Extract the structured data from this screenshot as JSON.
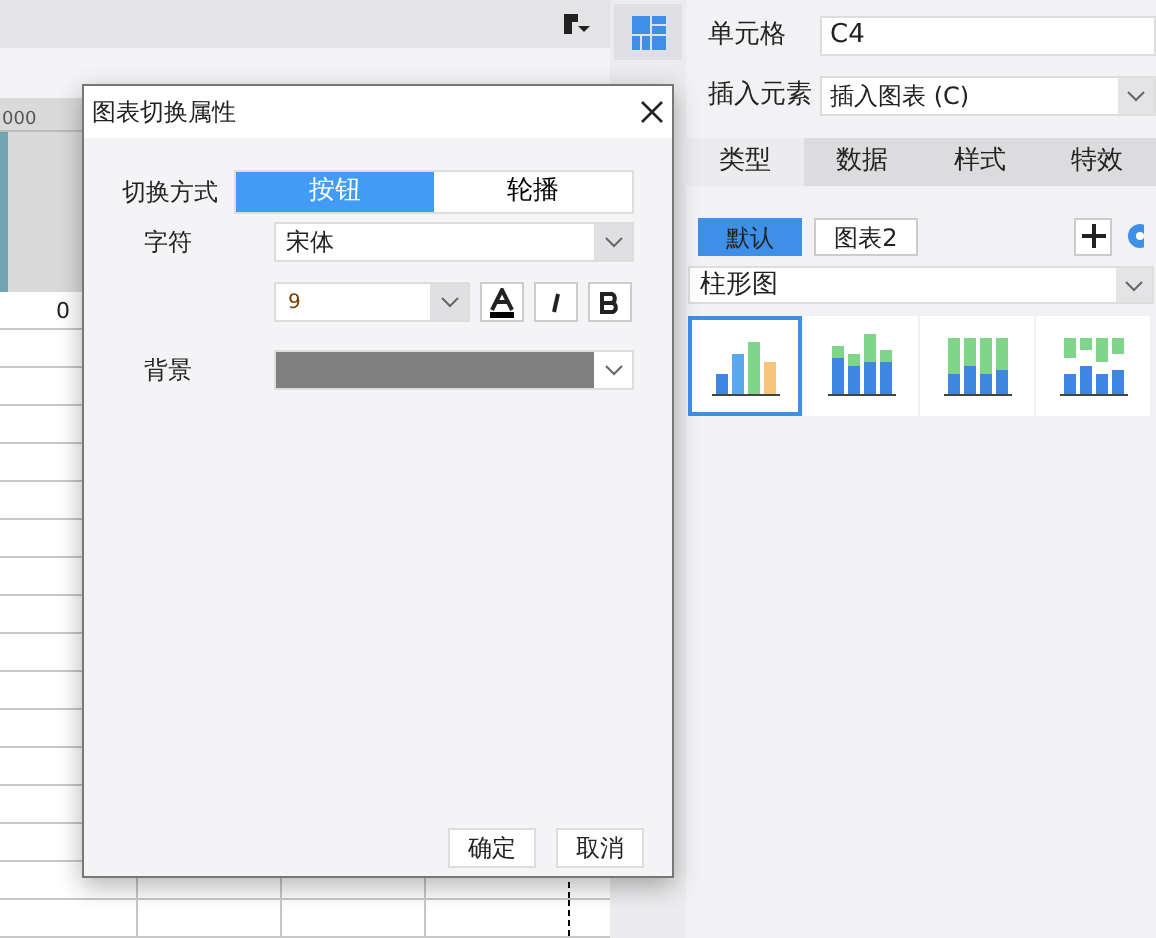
{
  "sheet": {
    "ruler_text": "000",
    "cell_value": "0"
  },
  "right_panel": {
    "cell_label": "单元格",
    "cell_value": "C4",
    "insert_label": "插入元素",
    "insert_value": "插入图表 (C)",
    "tabs": [
      {
        "label": "类型",
        "selected": true
      },
      {
        "label": "数据",
        "selected": false
      },
      {
        "label": "样式",
        "selected": false
      },
      {
        "label": "特效",
        "selected": false
      }
    ],
    "chart_tabs": [
      {
        "label": "默认",
        "selected": true
      },
      {
        "label": "图表2",
        "selected": false
      }
    ],
    "chart_type": "柱形图",
    "thumbnails": [
      {
        "kind": "clustered",
        "selected": true
      },
      {
        "kind": "stacked",
        "selected": false
      },
      {
        "kind": "percent",
        "selected": false
      },
      {
        "kind": "floating",
        "selected": false
      }
    ]
  },
  "dialog": {
    "title": "图表切换属性",
    "switch_label": "切换方式",
    "switch_options": [
      {
        "label": "按钮",
        "selected": true
      },
      {
        "label": "轮播",
        "selected": false
      }
    ],
    "font_label": "字符",
    "font_value": "宋体",
    "size_value": "9",
    "background_label": "背景",
    "buttons": [
      "确定",
      "取消"
    ]
  }
}
